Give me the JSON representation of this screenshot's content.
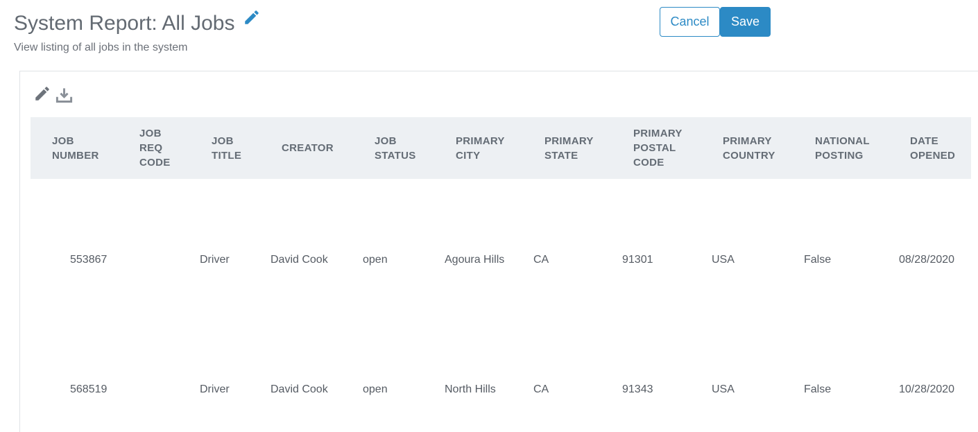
{
  "header": {
    "title": "System Report: All Jobs",
    "subtitle": "View listing of all jobs in the system"
  },
  "actions": {
    "cancel_label": "Cancel",
    "save_label": "Save"
  },
  "toolbar": {
    "edit_icon": "pencil-icon",
    "download_icon": "download-icon"
  },
  "colors": {
    "accent": "#2c8ac5",
    "header_bg": "#edf0f3",
    "text": "#555b63"
  },
  "table": {
    "columns": [
      [
        "JOB",
        "NUMBER"
      ],
      [
        "JOB",
        "REQ",
        "CODE"
      ],
      [
        "JOB",
        "TITLE"
      ],
      [
        "CREATOR"
      ],
      [
        "JOB",
        "STATUS"
      ],
      [
        "PRIMARY",
        "CITY"
      ],
      [
        "PRIMARY",
        "STATE"
      ],
      [
        "PRIMARY",
        "POSTAL",
        "CODE"
      ],
      [
        "PRIMARY",
        "COUNTRY"
      ],
      [
        "NATIONAL",
        "POSTING"
      ],
      [
        "DATE",
        "OPENED"
      ]
    ],
    "rows": [
      [
        "553867",
        "",
        "Driver",
        "David Cook",
        "open",
        "Agoura Hills",
        "CA",
        "91301",
        "USA",
        "False",
        "08/28/2020"
      ],
      [
        "568519",
        "",
        "Driver",
        "David Cook",
        "open",
        "North Hills",
        "CA",
        "91343",
        "USA",
        "False",
        "10/28/2020"
      ]
    ]
  }
}
